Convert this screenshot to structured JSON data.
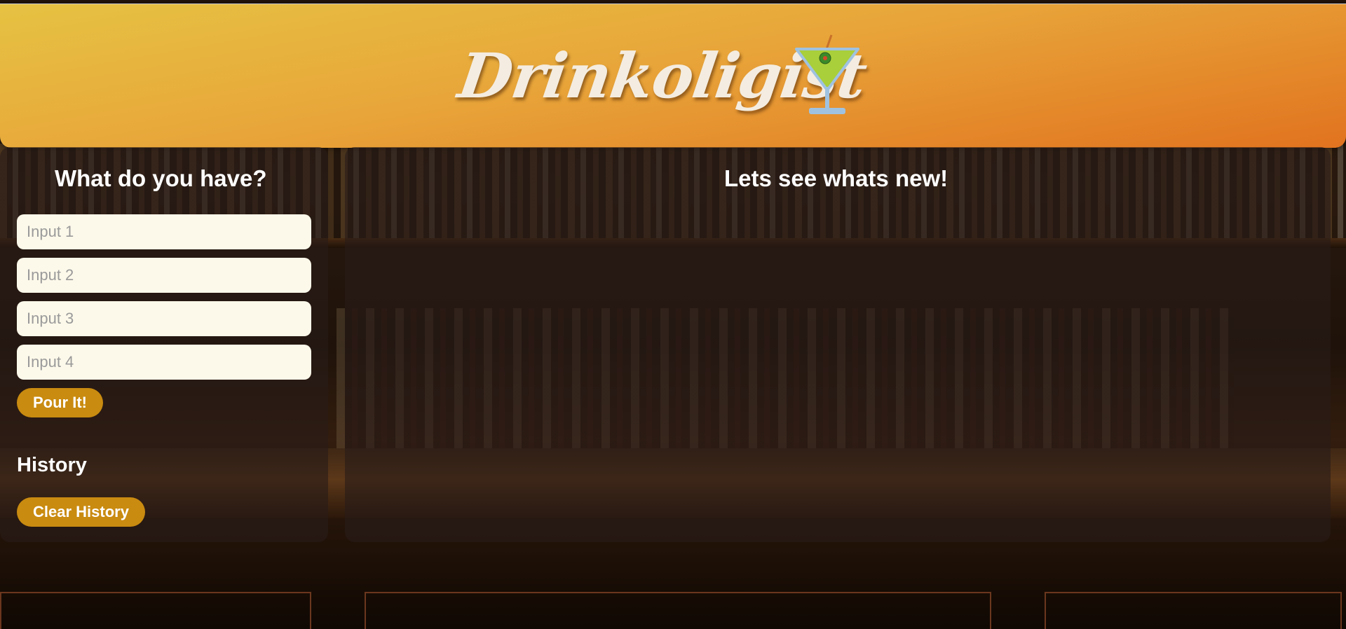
{
  "app": {
    "brand_title": "Drinkoligist",
    "logo_icon": "martini-glass-icon"
  },
  "search": {
    "title": "What do you have?",
    "inputs": [
      {
        "placeholder": "Input 1",
        "value": ""
      },
      {
        "placeholder": "Input 2",
        "value": ""
      },
      {
        "placeholder": "Input 3",
        "value": ""
      },
      {
        "placeholder": "Input 4",
        "value": ""
      }
    ],
    "submit_label": "Pour It!"
  },
  "history": {
    "title": "History",
    "clear_label": "Clear History"
  },
  "results": {
    "title": "Lets see whats new!"
  },
  "colors": {
    "header_gradient_start": "#e6c242",
    "header_gradient_end": "#e1731f",
    "button": "#c98b10",
    "input_background": "#fdf9ea",
    "brand_text": "#f4ece0"
  }
}
